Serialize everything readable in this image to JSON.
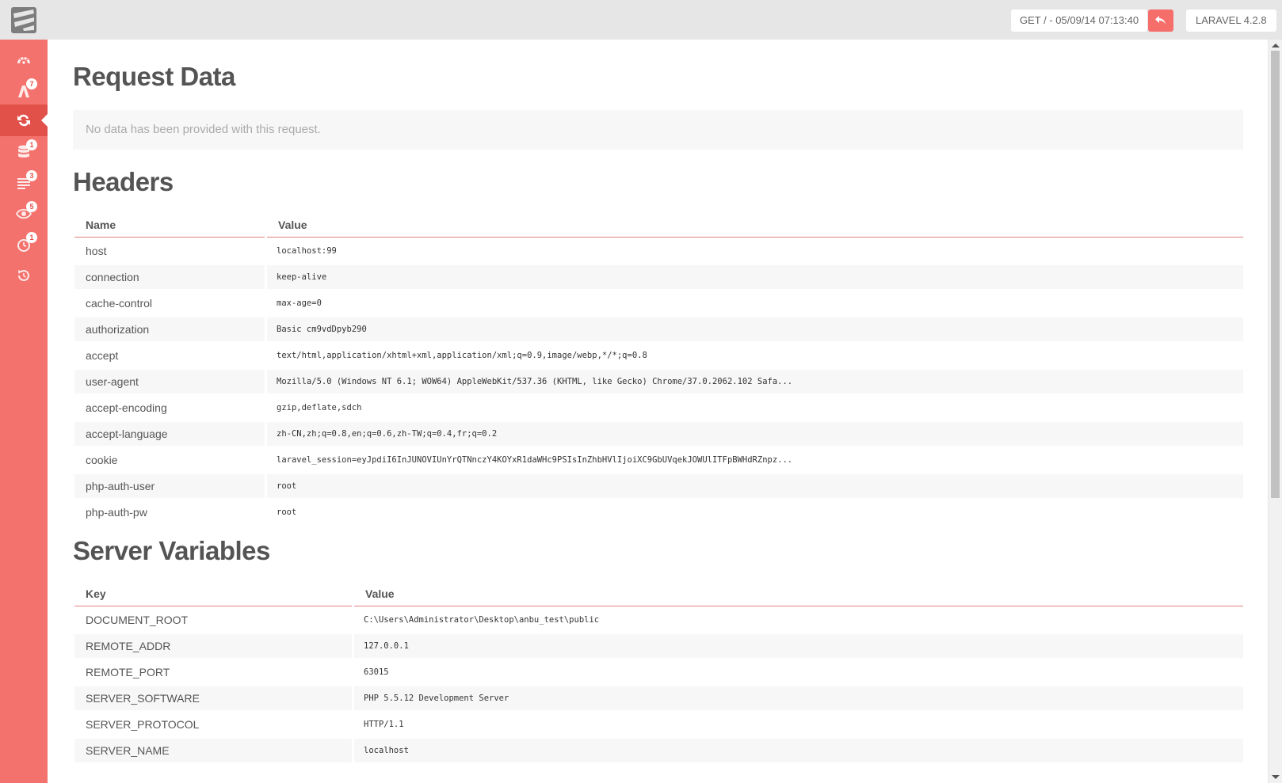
{
  "topbar": {
    "request_info": "GET / - 05/09/14 07:13:40",
    "version": "LARAVEL 4.2.8"
  },
  "sidebar": {
    "items": [
      {
        "icon": "dashboard-icon",
        "badge": ""
      },
      {
        "icon": "routes-icon",
        "badge": "7"
      },
      {
        "icon": "request-refresh-icon",
        "badge": "",
        "active": true
      },
      {
        "icon": "database-icon",
        "badge": "1"
      },
      {
        "icon": "logs-icon",
        "badge": "3"
      },
      {
        "icon": "events-eye-icon",
        "badge": "5"
      },
      {
        "icon": "timers-icon",
        "badge": "1"
      },
      {
        "icon": "history-icon",
        "badge": ""
      }
    ]
  },
  "request_data": {
    "title": "Request Data",
    "empty_message": "No data has been provided with this request."
  },
  "headers": {
    "title": "Headers",
    "col_name": "Name",
    "col_value": "Value",
    "rows": [
      {
        "name": "host",
        "value": "localhost:99"
      },
      {
        "name": "connection",
        "value": "keep-alive"
      },
      {
        "name": "cache-control",
        "value": "max-age=0"
      },
      {
        "name": "authorization",
        "value": "Basic cm9vdDpyb290"
      },
      {
        "name": "accept",
        "value": "text/html,application/xhtml+xml,application/xml;q=0.9,image/webp,*/*;q=0.8"
      },
      {
        "name": "user-agent",
        "value": "Mozilla/5.0 (Windows NT 6.1; WOW64) AppleWebKit/537.36 (KHTML, like Gecko) Chrome/37.0.2062.102 Safa..."
      },
      {
        "name": "accept-encoding",
        "value": "gzip,deflate,sdch"
      },
      {
        "name": "accept-language",
        "value": "zh-CN,zh;q=0.8,en;q=0.6,zh-TW;q=0.4,fr;q=0.2"
      },
      {
        "name": "cookie",
        "value": "laravel_session=eyJpdiI6InJUNOVIUnYrQTNnczY4KOYxR1daWHc9PSIsInZhbHVlIjoiXC9GbUVqekJOWUlITFpBWHdRZnpz..."
      },
      {
        "name": "php-auth-user",
        "value": "root"
      },
      {
        "name": "php-auth-pw",
        "value": "root"
      }
    ]
  },
  "server": {
    "title": "Server Variables",
    "col_key": "Key",
    "col_value": "Value",
    "rows": [
      {
        "key": "DOCUMENT_ROOT",
        "value": "C:\\Users\\Administrator\\Desktop\\anbu_test\\public"
      },
      {
        "key": "REMOTE_ADDR",
        "value": "127.0.0.1"
      },
      {
        "key": "REMOTE_PORT",
        "value": "63015"
      },
      {
        "key": "SERVER_SOFTWARE",
        "value": "PHP 5.5.12 Development Server"
      },
      {
        "key": "SERVER_PROTOCOL",
        "value": "HTTP/1.1"
      },
      {
        "key": "SERVER_NAME",
        "value": "localhost"
      }
    ]
  },
  "colors": {
    "sidebar": "#f4726d",
    "sidebar_active": "#e2504a",
    "accent": "#f56e6a"
  }
}
